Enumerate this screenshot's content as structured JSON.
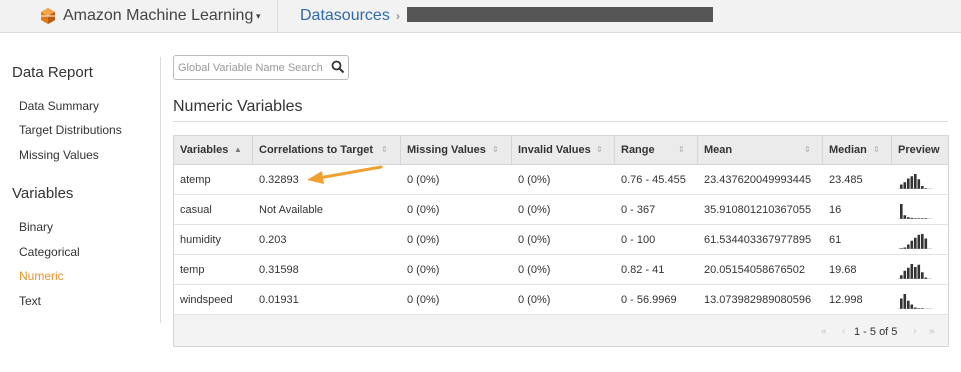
{
  "topbar": {
    "app_name": "Amazon Machine Learning",
    "app_caret": "▾",
    "breadcrumb": "Datasources",
    "breadcrumb_sep": "›"
  },
  "sidebar": {
    "data_report_title": "Data Report",
    "data_report_items": [
      "Data Summary",
      "Target Distributions",
      "Missing Values"
    ],
    "variables_title": "Variables",
    "variables_items": [
      "Binary",
      "Categorical",
      "Numeric",
      "Text"
    ],
    "active_item": "Numeric",
    "active_color": "#e8912b"
  },
  "search": {
    "placeholder": "Global Variable Name Search",
    "icon": "search-icon"
  },
  "main": {
    "title": "Numeric Variables"
  },
  "table": {
    "columns": [
      "Variables",
      "Correlations to Target",
      "Missing Values",
      "Invalid Values",
      "Range",
      "Mean",
      "Median",
      "Preview"
    ],
    "sort_indicator": "▲",
    "sortable_indicator": "⇕",
    "rows": [
      {
        "variable": "atemp",
        "correlation": "0.32893",
        "missing": "0 (0%)",
        "invalid": "0 (0%)",
        "range": "0.76 - 45.455",
        "mean": "23.437620049993445",
        "median": "23.485",
        "preview": [
          0.3,
          0.45,
          0.7,
          0.85,
          1.0,
          0.65,
          0.2,
          0.05
        ]
      },
      {
        "variable": "casual",
        "correlation": "Not Available",
        "missing": "0 (0%)",
        "invalid": "0 (0%)",
        "range": "0 - 367",
        "mean": "35.910801210367055",
        "median": "16",
        "preview": [
          1.0,
          0.25,
          0.12,
          0.08,
          0.05,
          0.04,
          0.03,
          0.02
        ]
      },
      {
        "variable": "humidity",
        "correlation": "0.203",
        "missing": "0 (0%)",
        "invalid": "0 (0%)",
        "range": "0 - 100",
        "mean": "61.534403367977895",
        "median": "61",
        "preview": [
          0.05,
          0.1,
          0.3,
          0.55,
          0.75,
          0.95,
          1.0,
          0.7
        ]
      },
      {
        "variable": "temp",
        "correlation": "0.31598",
        "missing": "0 (0%)",
        "invalid": "0 (0%)",
        "range": "0.82 - 41",
        "mean": "20.05154058676502",
        "median": "19.68",
        "preview": [
          0.25,
          0.55,
          0.75,
          1.0,
          0.8,
          0.95,
          0.45,
          0.1
        ]
      },
      {
        "variable": "windspeed",
        "correlation": "0.01931",
        "missing": "0 (0%)",
        "invalid": "0 (0%)",
        "range": "0 - 56.9969",
        "mean": "13.073982989080596",
        "median": "12.998",
        "preview": [
          0.7,
          1.0,
          0.55,
          0.3,
          0.1,
          0.04,
          0.02,
          0.0
        ]
      }
    ],
    "pager": {
      "first": "«",
      "prev": "‹",
      "text": "1 - 5 of 5",
      "next": "›",
      "last": "»"
    }
  },
  "colors": {
    "link_blue": "#2f6aa8",
    "accent_orange": "#f0a030",
    "preview_bar": "#333333"
  }
}
